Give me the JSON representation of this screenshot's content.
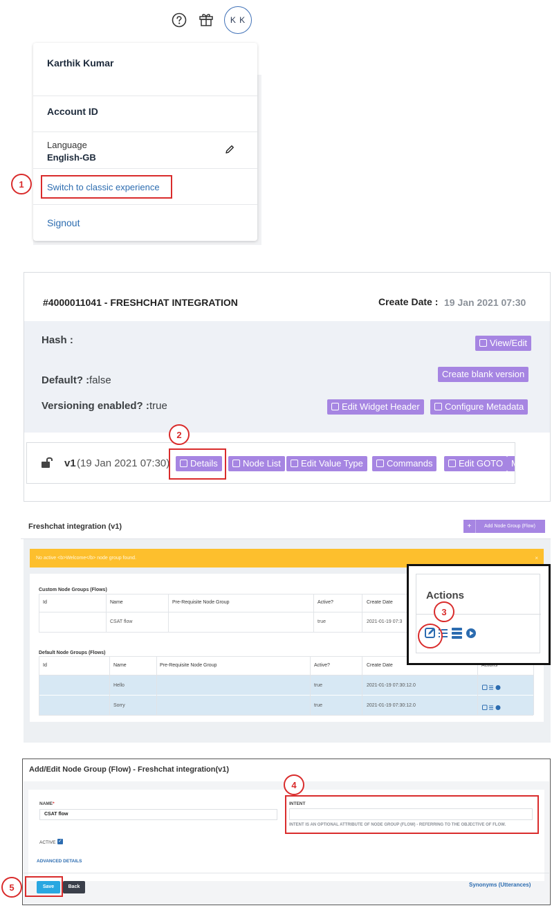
{
  "header": {
    "help_icon": "question-circle-icon",
    "gift_icon": "gift-icon",
    "avatar_initials": "K K"
  },
  "account_menu": {
    "user_name": "Karthik Kumar",
    "account_id_label": "Account ID",
    "language_label": "Language",
    "language_value": "English-GB",
    "switch_classic": "Switch to classic experience",
    "signout": "Signout"
  },
  "callouts": [
    "1",
    "2",
    "3",
    "4",
    "5"
  ],
  "bot_detail": {
    "title": "#4000011041 - FRESHCHAT INTEGRATION",
    "create_date_label": "Create Date :",
    "create_date_value": "19 Jan 2021 07:30",
    "hash_label": "Hash :",
    "default_label": "Default? :",
    "default_value": "false",
    "versioning_label": "Versioning enabled? :",
    "versioning_value": "true",
    "view_edit": "View/Edit",
    "create_blank_version": "Create blank version",
    "edit_widget_header": "Edit Widget Header",
    "configure_metadata": "Configure Metadata",
    "version": {
      "name": "v1",
      "date": "(19 Jan 2021 07:30)",
      "buttons": [
        "Details",
        "Node List",
        "Edit Value Type",
        "Commands",
        "Edit GOTO",
        "M"
      ]
    }
  },
  "node_groups": {
    "title": "Freshchat integration (v1)",
    "add_button": "Add Node Group (Flow)",
    "alert": "No active <b>Welcome</b> node group found.",
    "custom_section": "Custom Node Groups (Flows)",
    "custom_columns": [
      "Id",
      "Name",
      "Pre-Requisite Node Group",
      "Active?",
      "Create Date"
    ],
    "custom_rows": [
      {
        "id": "",
        "name": "CSAT flow",
        "prereq": "",
        "active": "true",
        "date": "2021-01-19 07:3"
      }
    ],
    "default_section": "Default Node Groups (Flows)",
    "default_columns": [
      "Id",
      "Name",
      "Pre-Requisite Node Group",
      "Active?",
      "Create Date",
      "Actions"
    ],
    "default_rows": [
      {
        "id": "",
        "name": "Hello",
        "prereq": "",
        "active": "true",
        "date": "2021-01-19 07:30:12.0"
      },
      {
        "id": "",
        "name": "Sorry",
        "prereq": "",
        "active": "true",
        "date": "2021-01-19 07:30:12.0"
      }
    ],
    "zoom_header": "Actions"
  },
  "add_edit_form": {
    "title": "Add/Edit Node Group (Flow) - Freshchat integration(v1)",
    "name_label": "NAME",
    "required_mark": "*",
    "name_value": "CSAT flow",
    "intent_label": "INTENT",
    "intent_value": "",
    "intent_help": "INTENT IS AN OPTIONAL ATTRIBUTE OF NODE GROUP (FLOW) - REFERRING TO THE OBJECTIVE OF FLOW.",
    "active_label": "ACTIVE",
    "active_checked": true,
    "advanced_details": "ADVANCED DETAILS",
    "save": "Save",
    "back": "Back",
    "synonyms": "Synonyms (Utterances)"
  },
  "colors": {
    "accent_purple": "#a685e2",
    "link_blue": "#2c6cb0",
    "annotation_red": "#d92b2b",
    "alert_yellow": "#fdbf2d",
    "row_highlight": "#d7e8f4",
    "save_blue": "#29a7e1"
  }
}
